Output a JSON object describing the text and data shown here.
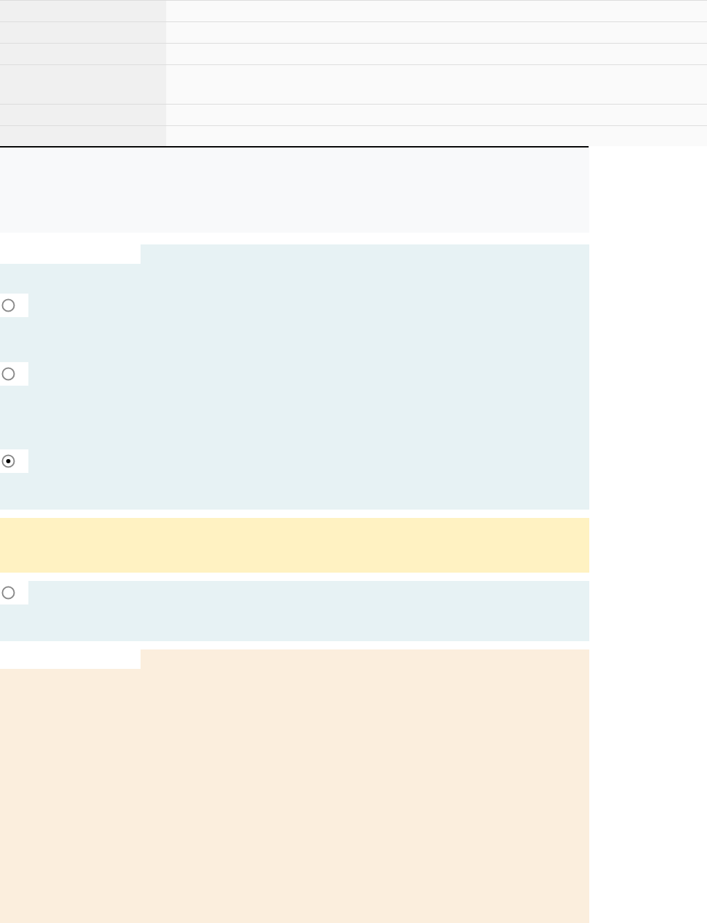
{
  "table": {
    "rows": [
      {
        "kind": "single"
      },
      {
        "kind": "single"
      },
      {
        "kind": "single"
      },
      {
        "kind": "double"
      },
      {
        "kind": "single"
      },
      {
        "kind": "single"
      }
    ]
  },
  "sections": [
    {
      "kind": "note",
      "tab": false
    },
    {
      "kind": "options",
      "tab": true,
      "options": [
        {
          "selected": false
        },
        {
          "selected": false
        },
        {
          "selected": true
        }
      ]
    },
    {
      "kind": "notice",
      "tab": false
    },
    {
      "kind": "options",
      "tab": false,
      "options": [
        {
          "selected": false
        }
      ]
    },
    {
      "kind": "content",
      "tab": true
    }
  ]
}
